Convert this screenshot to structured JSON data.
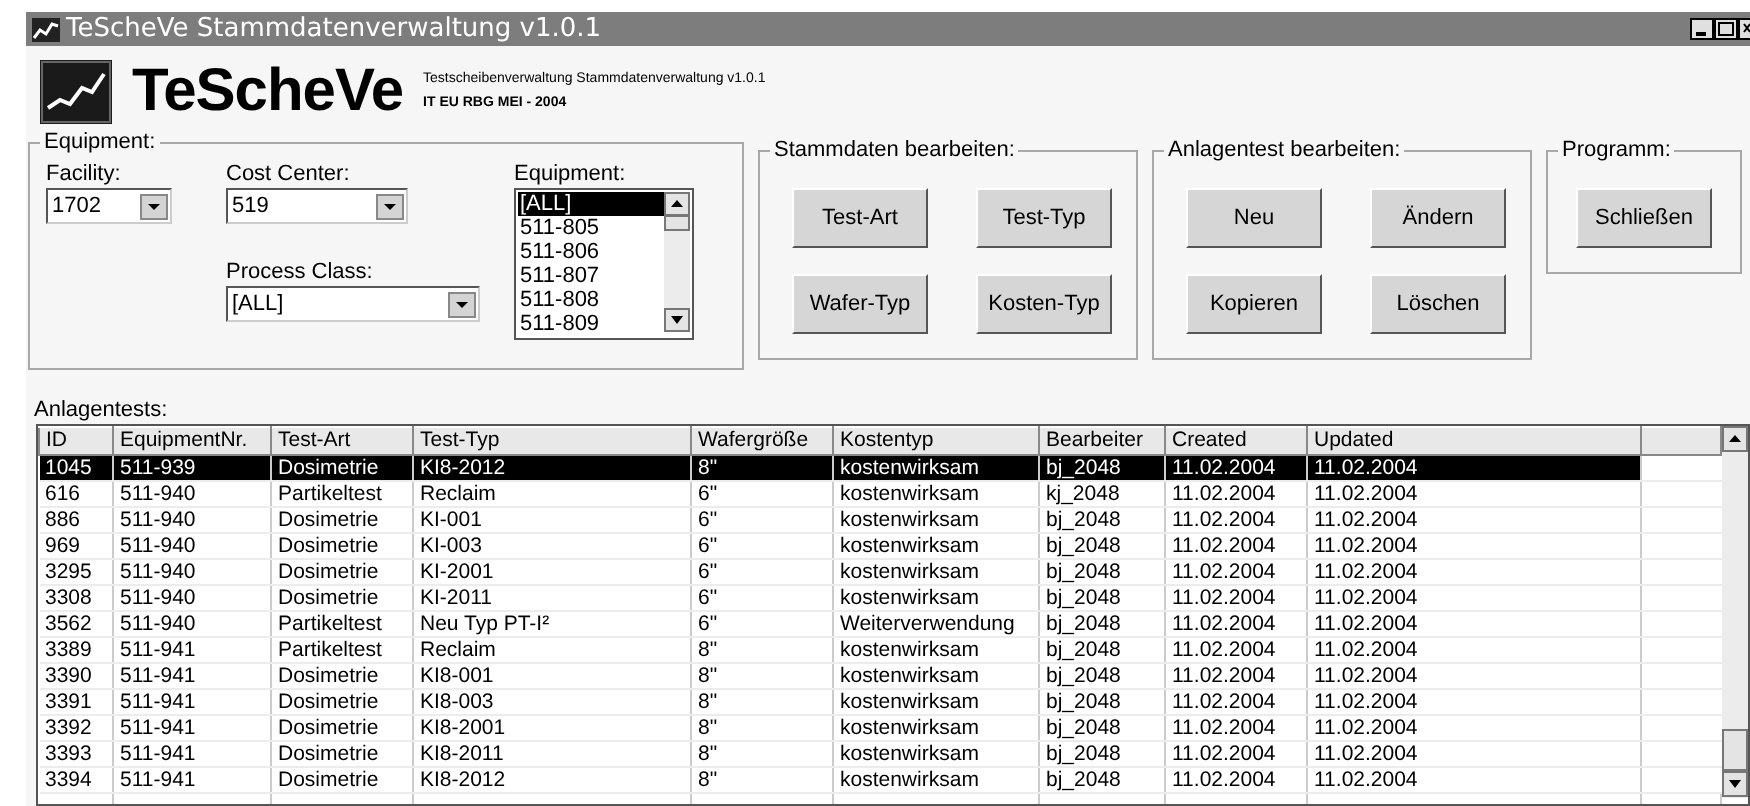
{
  "window": {
    "title": "TeScheVe Stammdatenverwaltung v1.0.1"
  },
  "header": {
    "app_name": "TeScheVe",
    "subtitle": "Testscheibenverwaltung Stammdatenverwaltung v1.0.1",
    "org": "IT EU RBG MEI - 2004"
  },
  "equipment_group": {
    "title": "Equipment:",
    "facility": {
      "label": "Facility:",
      "value": "1702"
    },
    "cost_center": {
      "label": "Cost Center:",
      "value": "519"
    },
    "process_class": {
      "label": "Process Class:",
      "value": "[ALL]"
    },
    "equipment": {
      "label": "Equipment:",
      "items": [
        {
          "text": "[ALL]",
          "selected": true
        },
        {
          "text": "511-805",
          "selected": false
        },
        {
          "text": "511-806",
          "selected": false
        },
        {
          "text": "511-807",
          "selected": false
        },
        {
          "text": "511-808",
          "selected": false
        },
        {
          "text": "511-809",
          "selected": false
        }
      ]
    }
  },
  "button_groups": [
    {
      "title": "Stammdaten bearbeiten:",
      "buttons": [
        "Test-Art",
        "Test-Typ",
        "Wafer-Typ",
        "Kosten-Typ"
      ]
    },
    {
      "title": "Anlagentest bearbeiten:",
      "buttons": [
        "Neu",
        "Ändern",
        "Kopieren",
        "Löschen"
      ]
    },
    {
      "title": "Programm:",
      "buttons": [
        "Schließen"
      ]
    }
  ],
  "table": {
    "label": "Anlagentests:",
    "columns": [
      "ID",
      "EquipmentNr.",
      "Test-Art",
      "Test-Typ",
      "Wafergröße",
      "Kostentyp",
      "Bearbeiter",
      "Created",
      "Updated"
    ],
    "rows": [
      {
        "cells": [
          "1045",
          "511-939",
          "Dosimetrie",
          "KI8-2012",
          "8\"",
          "kostenwirksam",
          "bj_2048",
          "11.02.2004",
          "11.02.2004"
        ],
        "selected": true
      },
      {
        "cells": [
          "616",
          "511-940",
          "Partikeltest",
          "Reclaim",
          "6\"",
          "kostenwirksam",
          "kj_2048",
          "11.02.2004",
          "11.02.2004"
        ],
        "selected": false
      },
      {
        "cells": [
          "886",
          "511-940",
          "Dosimetrie",
          "KI-001",
          "6\"",
          "kostenwirksam",
          "bj_2048",
          "11.02.2004",
          "11.02.2004"
        ],
        "selected": false
      },
      {
        "cells": [
          "969",
          "511-940",
          "Dosimetrie",
          "KI-003",
          "6\"",
          "kostenwirksam",
          "bj_2048",
          "11.02.2004",
          "11.02.2004"
        ],
        "selected": false
      },
      {
        "cells": [
          "3295",
          "511-940",
          "Dosimetrie",
          "KI-2001",
          "6\"",
          "kostenwirksam",
          "bj_2048",
          "11.02.2004",
          "11.02.2004"
        ],
        "selected": false
      },
      {
        "cells": [
          "3308",
          "511-940",
          "Dosimetrie",
          "KI-2011",
          "6\"",
          "kostenwirksam",
          "bj_2048",
          "11.02.2004",
          "11.02.2004"
        ],
        "selected": false
      },
      {
        "cells": [
          "3562",
          "511-940",
          "Partikeltest",
          "Neu Typ PT-I²",
          "6\"",
          "Weiterverwendung",
          "bj_2048",
          "11.02.2004",
          "11.02.2004"
        ],
        "selected": false
      },
      {
        "cells": [
          "3389",
          "511-941",
          "Partikeltest",
          "Reclaim",
          "8\"",
          "kostenwirksam",
          "bj_2048",
          "11.02.2004",
          "11.02.2004"
        ],
        "selected": false
      },
      {
        "cells": [
          "3390",
          "511-941",
          "Dosimetrie",
          "KI8-001",
          "8\"",
          "kostenwirksam",
          "bj_2048",
          "11.02.2004",
          "11.02.2004"
        ],
        "selected": false
      },
      {
        "cells": [
          "3391",
          "511-941",
          "Dosimetrie",
          "KI8-003",
          "8\"",
          "kostenwirksam",
          "bj_2048",
          "11.02.2004",
          "11.02.2004"
        ],
        "selected": false
      },
      {
        "cells": [
          "3392",
          "511-941",
          "Dosimetrie",
          "KI8-2001",
          "8\"",
          "kostenwirksam",
          "bj_2048",
          "11.02.2004",
          "11.02.2004"
        ],
        "selected": false
      },
      {
        "cells": [
          "3393",
          "511-941",
          "Dosimetrie",
          "KI8-2011",
          "8\"",
          "kostenwirksam",
          "bj_2048",
          "11.02.2004",
          "11.02.2004"
        ],
        "selected": false
      },
      {
        "cells": [
          "3394",
          "511-941",
          "Dosimetrie",
          "KI8-2012",
          "8\"",
          "kostenwirksam",
          "bj_2048",
          "11.02.2004",
          "11.02.2004"
        ],
        "selected": false
      }
    ]
  }
}
